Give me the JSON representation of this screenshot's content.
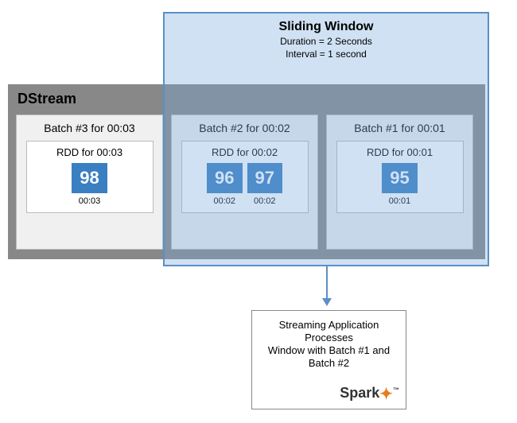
{
  "sliding_window": {
    "title": "Sliding Window",
    "duration_label": "Duration = 2 Seconds",
    "interval_label": "Interval = 1 second"
  },
  "dstream": {
    "label": "DStream",
    "batches": [
      {
        "title": "Batch #3 for 00:03",
        "rdd_title": "RDD for 00:03",
        "items": [
          {
            "value": "98",
            "time": "00:03"
          }
        ]
      },
      {
        "title": "Batch #2 for 00:02",
        "rdd_title": "RDD for 00:02",
        "items": [
          {
            "value": "96",
            "time": "00:02"
          },
          {
            "value": "97",
            "time": "00:02"
          }
        ]
      },
      {
        "title": "Batch #1 for 00:01",
        "rdd_title": "RDD for 00:01",
        "items": [
          {
            "value": "95",
            "time": "00:01"
          }
        ]
      }
    ]
  },
  "app_box": {
    "line1": "Streaming Application",
    "line2": "Processes",
    "line3": "Window with Batch #1 and",
    "line4": "Batch #2",
    "logo_text": "Spark",
    "logo_tm": "™"
  },
  "colors": {
    "accent": "#3a7fc2",
    "window_fill": "rgba(120,170,220,0.35)",
    "window_border": "#5a8fc8",
    "dstream_bg": "#888"
  }
}
